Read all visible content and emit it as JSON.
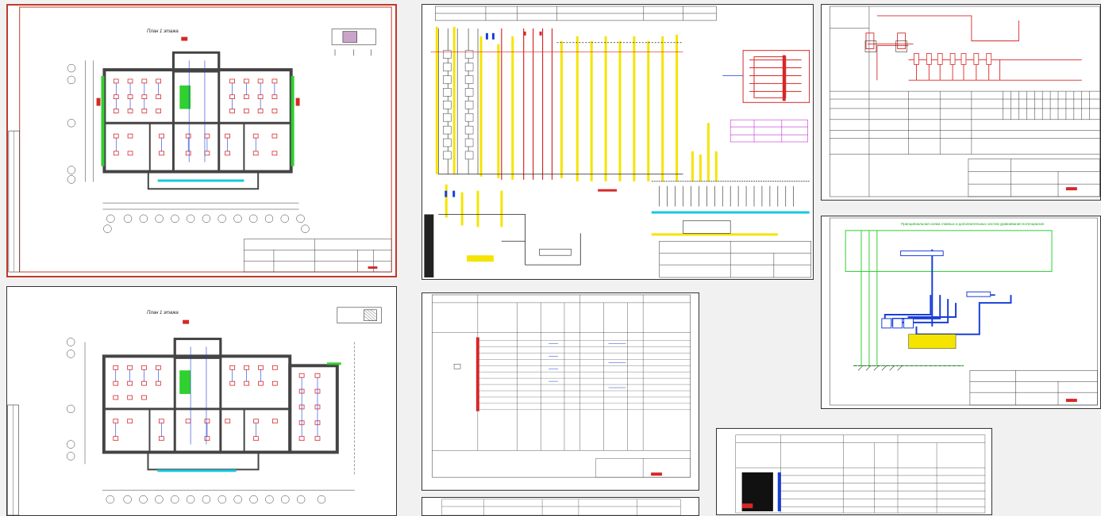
{
  "sheets": {
    "plan1": {
      "title": "План 1 этажа"
    },
    "plan2": {
      "title": "План 1 этажа"
    },
    "tables": {
      "dash": "- - -"
    },
    "scheme": {
      "title": "Принципиальная схема главных и дополнительных систем уравнивания потенциалов"
    }
  },
  "colors": {
    "wall": "#444444",
    "fixture": "#d62828",
    "wire": "#1a3fd6",
    "cyan": "#16c7e0",
    "yellow": "#f5e400",
    "green": "#2fd02f",
    "selected_border": "#c0392b"
  }
}
